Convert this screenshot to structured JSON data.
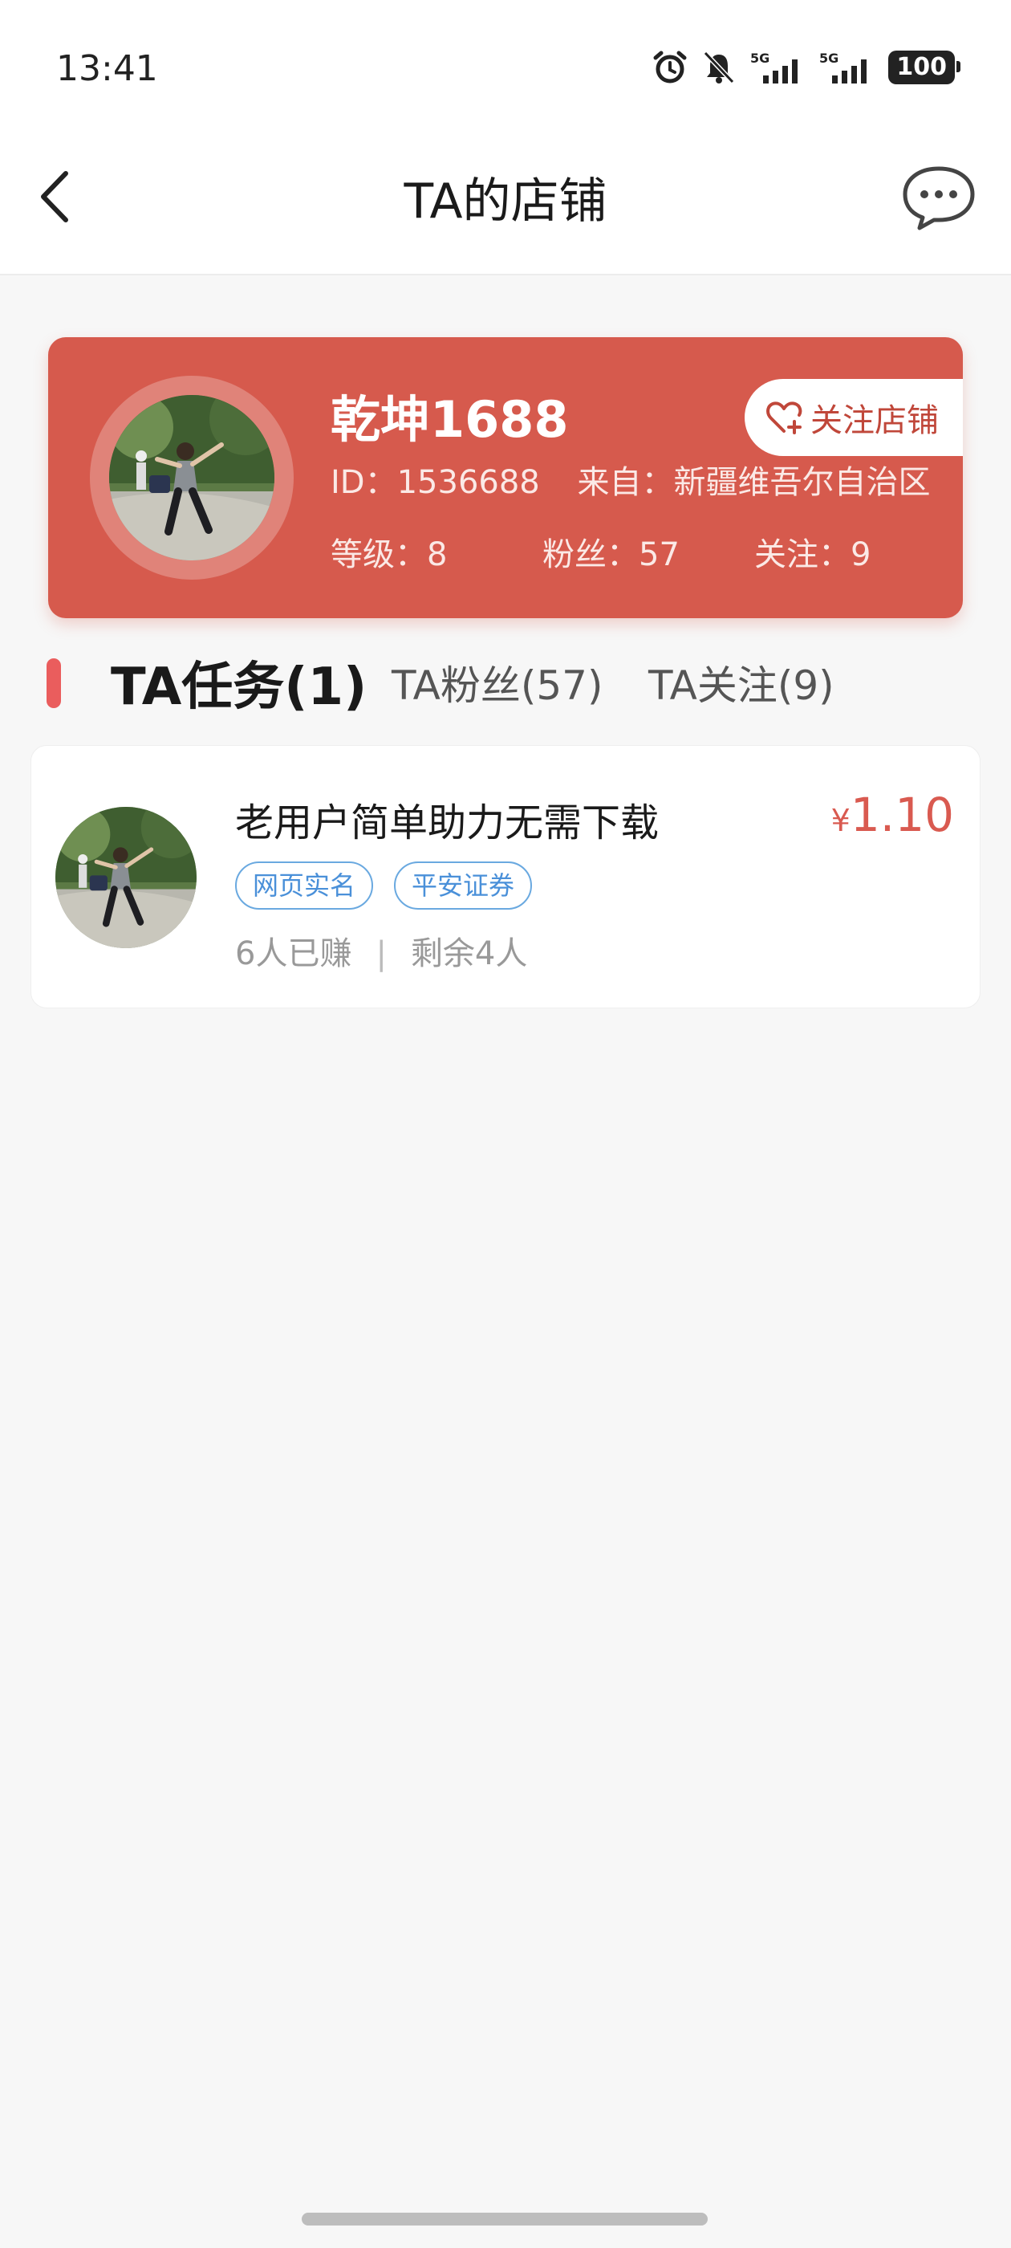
{
  "status_bar": {
    "time": "13:41",
    "battery": "100",
    "icons": [
      "alarm-icon",
      "bell-muted-icon",
      "signal-5g-icon",
      "signal-5g-icon"
    ]
  },
  "nav": {
    "title": "TA的店铺",
    "back_icon": "chevron-left-icon",
    "message_icon": "chat-bubble-icon"
  },
  "shop": {
    "name": "乾坤1688",
    "id_label": "ID：1536688",
    "from_label": "来自：新疆维吾尔自治区",
    "level_label": "等级：8",
    "fans_label": "粉丝：57",
    "follows_label": "关注：9",
    "follow_button": "关注店铺",
    "accent_color": "#d65a4d"
  },
  "tabs": [
    {
      "label": "TA任务(1)",
      "active": true
    },
    {
      "label": "TA粉丝(57)",
      "active": false
    },
    {
      "label": "TA关注(9)",
      "active": false
    }
  ],
  "tasks": [
    {
      "title": "老用户简单助力无需下载",
      "tags": [
        "网页实名",
        "平安证券"
      ],
      "earned": "6人已赚",
      "separator": "|",
      "remaining": "剩余4人",
      "currency": "¥",
      "price": "1.10"
    }
  ]
}
